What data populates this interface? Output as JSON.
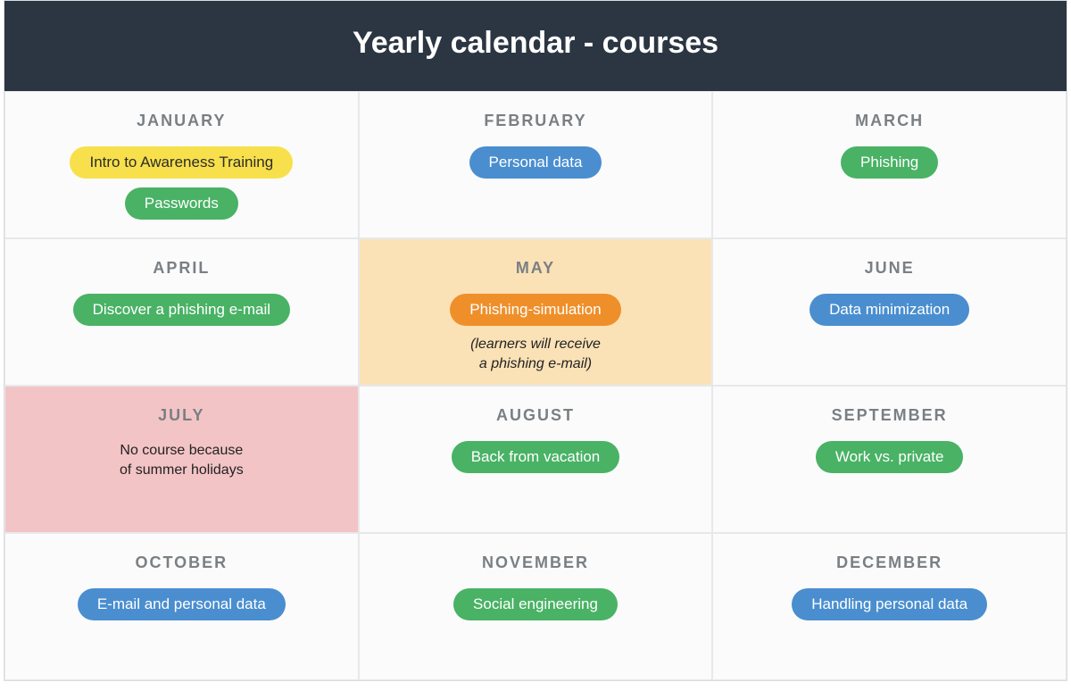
{
  "title": "Yearly calendar - courses",
  "months": [
    {
      "name": "JANUARY",
      "highlight": "",
      "courses": [
        {
          "label": "Intro to Awareness Training",
          "color": "yellow"
        },
        {
          "label": "Passwords",
          "color": "green"
        }
      ],
      "note": "",
      "noteItalic": false
    },
    {
      "name": "FEBRUARY",
      "highlight": "",
      "courses": [
        {
          "label": "Personal data",
          "color": "blue"
        }
      ],
      "note": "",
      "noteItalic": false
    },
    {
      "name": "MARCH",
      "highlight": "",
      "courses": [
        {
          "label": "Phishing",
          "color": "green"
        }
      ],
      "note": "",
      "noteItalic": false
    },
    {
      "name": "APRIL",
      "highlight": "",
      "courses": [
        {
          "label": "Discover a phishing e-mail",
          "color": "green"
        }
      ],
      "note": "",
      "noteItalic": false
    },
    {
      "name": "MAY",
      "highlight": "peach",
      "courses": [
        {
          "label": "Phishing-simulation",
          "color": "orange"
        }
      ],
      "note": "(learners will receive\na phishing e-mail)",
      "noteItalic": true
    },
    {
      "name": "JUNE",
      "highlight": "",
      "courses": [
        {
          "label": "Data minimization",
          "color": "blue"
        }
      ],
      "note": "",
      "noteItalic": false
    },
    {
      "name": "JULY",
      "highlight": "pink",
      "courses": [],
      "note": "No course because\nof summer holidays",
      "noteItalic": false
    },
    {
      "name": "AUGUST",
      "highlight": "",
      "courses": [
        {
          "label": "Back from vacation",
          "color": "green"
        }
      ],
      "note": "",
      "noteItalic": false
    },
    {
      "name": "SEPTEMBER",
      "highlight": "",
      "courses": [
        {
          "label": "Work vs. private",
          "color": "green"
        }
      ],
      "note": "",
      "noteItalic": false
    },
    {
      "name": "OCTOBER",
      "highlight": "",
      "courses": [
        {
          "label": "E-mail and personal data",
          "color": "blue"
        }
      ],
      "note": "",
      "noteItalic": false
    },
    {
      "name": "NOVEMBER",
      "highlight": "",
      "courses": [
        {
          "label": "Social engineering",
          "color": "green"
        }
      ],
      "note": "",
      "noteItalic": false
    },
    {
      "name": "DECEMBER",
      "highlight": "",
      "courses": [
        {
          "label": "Handling personal data",
          "color": "blue"
        }
      ],
      "note": "",
      "noteItalic": false
    }
  ]
}
